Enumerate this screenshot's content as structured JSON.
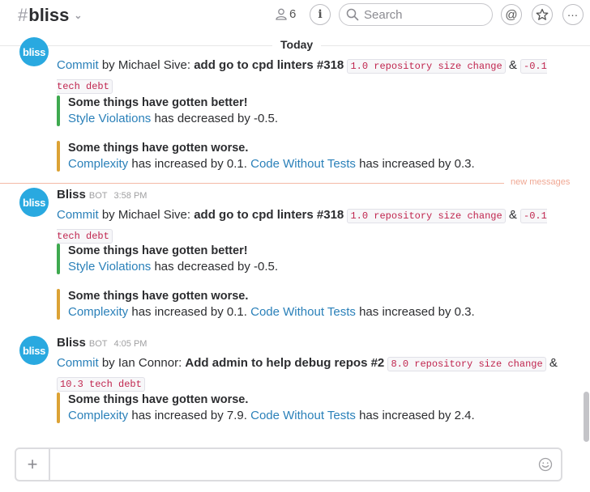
{
  "header": {
    "channel_hash": "#",
    "channel_name": "bliss",
    "member_count": "6",
    "search_placeholder": "Search"
  },
  "day_divider": "Today",
  "new_messages_label": "new messages",
  "avatar_text": "bliss",
  "messages": [
    {
      "commit_link": "Commit",
      "by_text": " by Michael Sive: ",
      "title": "add go to cpd linters #318",
      "tag1": "1.0 repository size change",
      "amp": "&",
      "tag2": "-0.1 tech debt",
      "better_title": "Some things have gotten better!",
      "better_metric": "Style Violations",
      "better_text": " has decreased by -0.5.",
      "worse_title": "Some things have gotten worse.",
      "worse_metric1": "Complexity",
      "worse_text1": " has increased by 0.1. ",
      "worse_metric2": "Code Without Tests",
      "worse_text2": " has increased by 0.3."
    },
    {
      "sender": "Bliss",
      "bot": "BOT",
      "time": "3:58 PM",
      "commit_link": "Commit",
      "by_text": " by Michael Sive: ",
      "title": "add go to cpd linters #318",
      "tag1": "1.0 repository size change",
      "amp": "&",
      "tag2": "-0.1 tech debt",
      "better_title": "Some things have gotten better!",
      "better_metric": "Style Violations",
      "better_text": " has decreased by -0.5.",
      "worse_title": "Some things have gotten worse.",
      "worse_metric1": "Complexity",
      "worse_text1": " has increased by 0.1. ",
      "worse_metric2": "Code Without Tests",
      "worse_text2": " has increased by 0.3."
    },
    {
      "sender": "Bliss",
      "bot": "BOT",
      "time": "4:05 PM",
      "commit_link": "Commit",
      "by_text": " by Ian Connor: ",
      "title": "Add admin to help debug repos #2",
      "tag1": "8.0 repository size change",
      "amp": "&",
      "tag2": "10.3 tech debt",
      "worse_title": "Some things have gotten worse.",
      "worse_metric1": "Complexity",
      "worse_text1": " has increased by 7.9. ",
      "worse_metric2": "Code Without Tests",
      "worse_text2": " has increased by 2.4."
    }
  ],
  "composer": {
    "plus": "+"
  },
  "icons": {
    "member": "person-icon",
    "info": "info-icon",
    "search": "search-icon",
    "mentions": "at-sign-icon",
    "star": "star-icon",
    "more": "more-icon",
    "emoji": "emoji-icon"
  }
}
